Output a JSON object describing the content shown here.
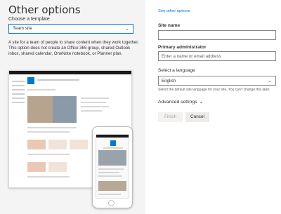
{
  "left": {
    "title": "Other options",
    "choose_label": "Choose a template",
    "template_value": "Team site",
    "description": "A site for a team of people to share content when they work together. This option does not create an Office 365 group, shared Outlook inbox, shared calendar, OneNote notebook, or Planner plan."
  },
  "right": {
    "see_other_link": "See other options",
    "site_name_label": "Site name",
    "site_name_value": "",
    "primary_admin_label": "Primary administrator",
    "primary_admin_placeholder": "Enter a name or email address",
    "language_label": "Select a language",
    "language_value": "English",
    "language_hint": "Select the default site language for your site. You can't change this later.",
    "advanced_label": "Advanced settings",
    "finish_label": "Finish",
    "cancel_label": "Cancel"
  },
  "icons": {
    "template_chevron": "chevron-down-icon",
    "language_chevron": "chevron-down-icon",
    "advanced_chevron": "chevron-down-icon"
  },
  "colors": {
    "accent": "#0078d4",
    "left_panel_bg": "#f4f4f4"
  }
}
